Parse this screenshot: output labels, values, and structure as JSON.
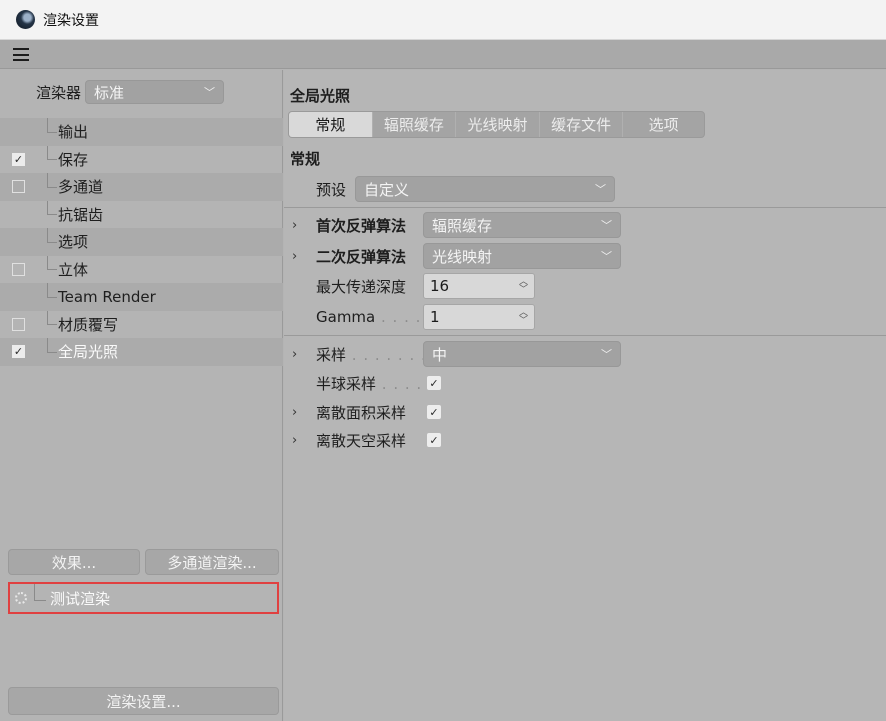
{
  "window": {
    "title": "渲染设置"
  },
  "left_panel": {
    "renderer_label": "渲染器",
    "renderer_value": "标准",
    "tree": [
      {
        "label": "输出",
        "checkbox": "none",
        "shaded": true
      },
      {
        "label": "保存",
        "checkbox": "checked",
        "shaded": false
      },
      {
        "label": "多通道",
        "checkbox": "unchecked",
        "shaded": true
      },
      {
        "label": "抗锯齿",
        "checkbox": "none",
        "shaded": false
      },
      {
        "label": "选项",
        "checkbox": "none",
        "shaded": true
      },
      {
        "label": "立体",
        "checkbox": "unchecked",
        "shaded": false
      },
      {
        "label": "Team Render",
        "checkbox": "none",
        "shaded": true
      },
      {
        "label": "材质覆写",
        "checkbox": "unchecked",
        "shaded": false
      },
      {
        "label": "全局光照",
        "checkbox": "checked",
        "shaded": true,
        "active": true
      }
    ],
    "effects_button": "效果...",
    "multipass_button": "多通道渲染...",
    "preset_item": "测试渲染",
    "render_settings_button": "渲染设置..."
  },
  "right_panel": {
    "section_title": "全局光照",
    "tabs": [
      {
        "label": "常规",
        "active": true
      },
      {
        "label": "辐照缓存",
        "active": false
      },
      {
        "label": "光线映射",
        "active": false
      },
      {
        "label": "缓存文件",
        "active": false
      },
      {
        "label": "选项",
        "active": false
      }
    ],
    "subsection_title": "常规",
    "preset_label": "预设",
    "preset_value": "自定义",
    "primary_method_label": "首次反弹算法",
    "primary_method_value": "辐照缓存",
    "secondary_method_label": "二次反弹算法",
    "secondary_method_value": "光线映射",
    "max_depth_label": "最大传递深度",
    "max_depth_value": "16",
    "gamma_label": "Gamma",
    "gamma_value": "1",
    "samples_label": "采样",
    "samples_value": "中",
    "hemisphere_label": "半球采样",
    "hemisphere_checked": true,
    "area_sampling_label": "离散面积采样",
    "area_sampling_checked": true,
    "sky_sampling_label": "离散天空采样",
    "sky_sampling_checked": true
  }
}
